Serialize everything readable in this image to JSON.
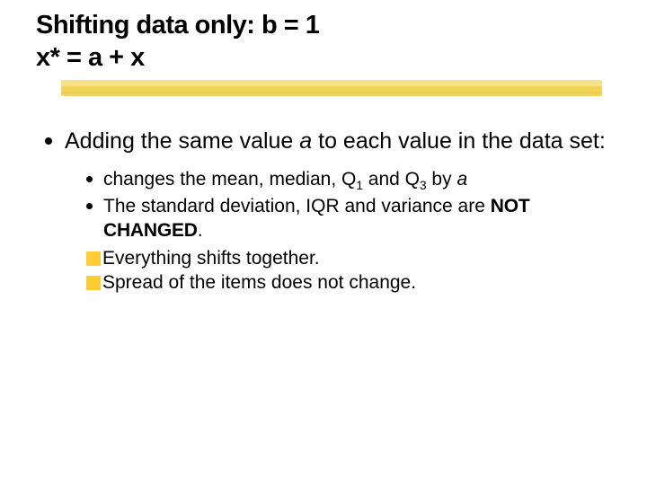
{
  "title": {
    "line1": "Shifting data only: b = 1",
    "line2": "x* = a + x"
  },
  "body": {
    "lead_pre": "Adding the same value ",
    "lead_ital": "a",
    "lead_post": " to each value in the data set:",
    "sub1_pre": "changes the mean, median, Q",
    "sub1_s1": "1",
    "sub1_mid": " and Q",
    "sub1_s3": "3",
    "sub1_post_pre": " by ",
    "sub1_post_ital": "a",
    "sub2_pre": "The standard deviation, IQR and variance are ",
    "sub2_bold": "NOT CHANGED",
    "sub2_post": ".",
    "y1": "Everything shifts together.",
    "y2": "Spread of the items does not change."
  }
}
